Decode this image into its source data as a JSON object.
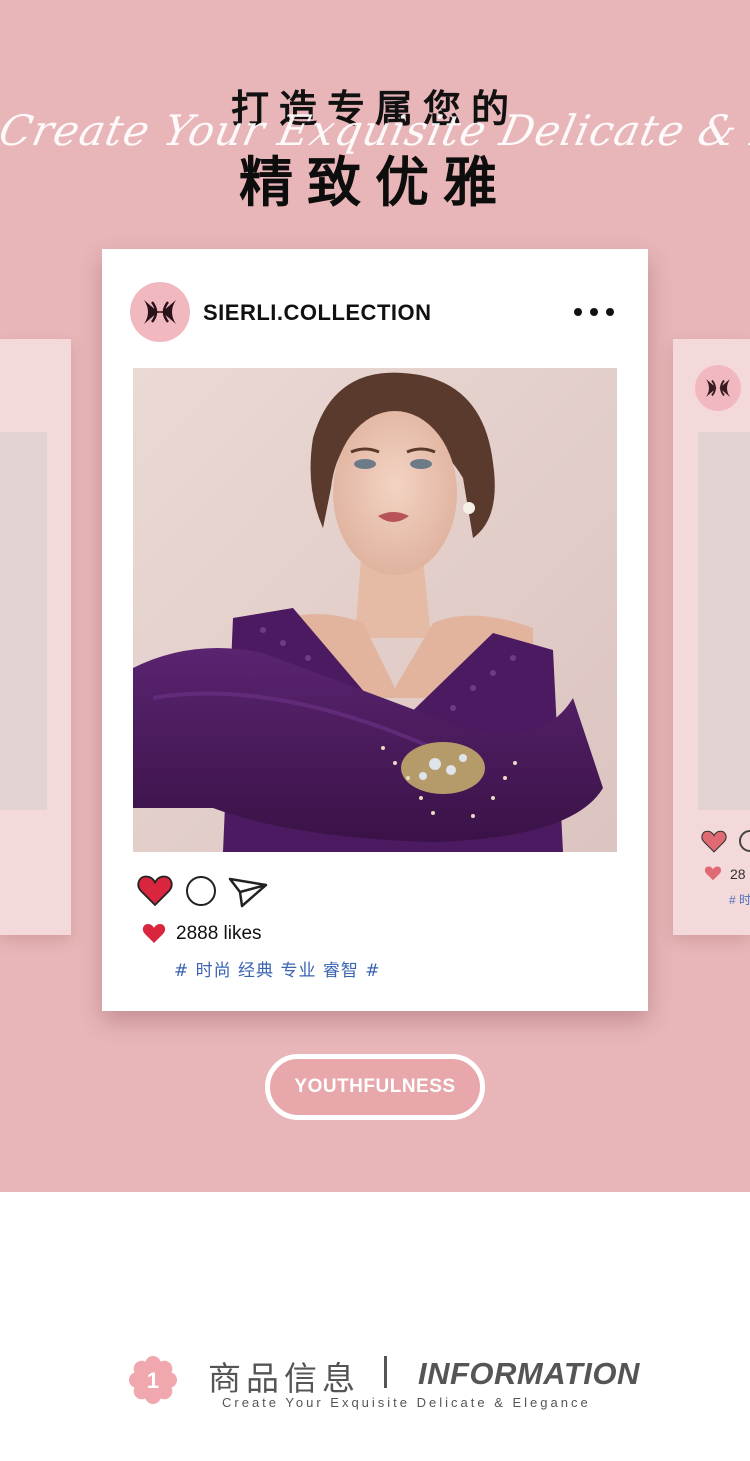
{
  "header": {
    "title_cn_1": "打造专属您的",
    "script_en": "Create Your Exquisite Delicate & Elegance",
    "title_cn_2": "精致优雅"
  },
  "post": {
    "account": "SIERLI.COLLECTION",
    "likes": "2888 likes",
    "tags": "# 时尚 经典 专业 睿智 #"
  },
  "side_card": {
    "likes_partial": "28",
    "tag_partial": "# 时"
  },
  "button": {
    "label": "YOUTHFULNESS"
  },
  "info": {
    "number": "1",
    "title_cn": "商品信息",
    "title_en": "INFORMATION",
    "subtitle": "Create Your Exquisite Delicate & Elegance"
  },
  "colors": {
    "background_pink": "#e8b6b8",
    "card_white": "#ffffff",
    "heart_red": "#d9263e",
    "tag_blue": "#3a63b0",
    "dress_purple": "#4b1a5a"
  },
  "icons": [
    "logo-icon",
    "more-icon",
    "heart-icon",
    "comment-icon",
    "share-icon",
    "flower-icon"
  ]
}
